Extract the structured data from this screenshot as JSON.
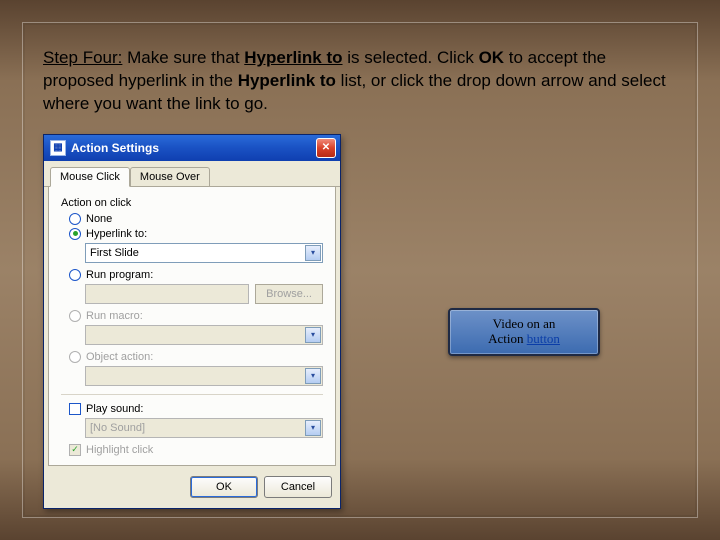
{
  "instruction": {
    "prefix_underlined": "Step Four:",
    "part1": " Make sure that ",
    "bold_underlined_1": "Hyperlink to",
    "part2": " is selected. Click ",
    "bold_1": "OK",
    "part3": " to accept the proposed hyperlink in the ",
    "bold_2": "Hyperlink to",
    "part4": " list, or click the drop down arrow and select where you want the link to go."
  },
  "dialog": {
    "title": "Action Settings",
    "tabs": {
      "mouse_click": "Mouse Click",
      "mouse_over": "Mouse Over"
    },
    "group_label": "Action on click",
    "radios": {
      "none": "None",
      "hyperlink_to": "Hyperlink to:",
      "run_program": "Run program:",
      "run_macro": "Run macro:",
      "object_action": "Object action:"
    },
    "hyperlink_value": "First Slide",
    "browse_label": "Browse...",
    "play_sound_label": "Play sound:",
    "sound_value": "[No Sound]",
    "highlight_label": "Highlight click",
    "buttons": {
      "ok": "OK",
      "cancel": "Cancel"
    }
  },
  "video_button": {
    "line1": "Video on an",
    "line2_prefix": "Action ",
    "line2_link": "button"
  }
}
